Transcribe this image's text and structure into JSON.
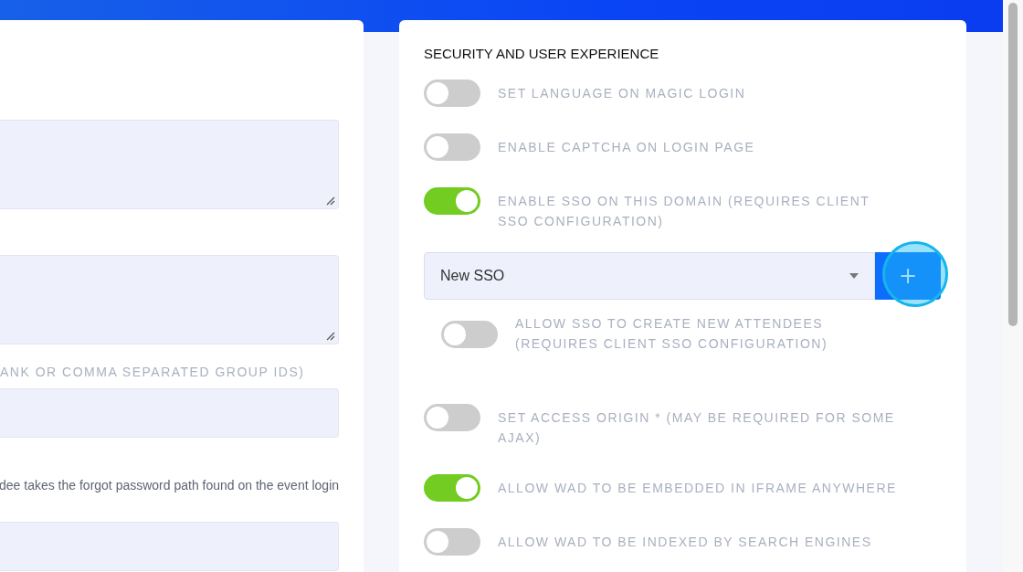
{
  "left_panel": {
    "fields": [
      {
        "kind": "textarea"
      },
      {
        "kind": "textarea"
      },
      {
        "kind": "input",
        "label": "ANK OR COMMA SEPARATED GROUP IDS)"
      },
      {
        "kind": "input",
        "description": "dee takes the forgot password path found on the event login"
      }
    ]
  },
  "security": {
    "title": "SECURITY AND USER EXPERIENCE",
    "items": [
      {
        "kind": "toggle",
        "label": "SET LANGUAGE ON MAGIC LOGIN",
        "on": false
      },
      {
        "kind": "toggle",
        "label": "ENABLE CAPTCHA ON LOGIN PAGE",
        "on": false
      },
      {
        "kind": "toggle",
        "label": "ENABLE SSO ON THIS DOMAIN (REQUIRES CLIENT SSO CONFIGURATION)",
        "on": true
      },
      {
        "kind": "select",
        "value": "New SSO",
        "button": "+"
      },
      {
        "kind": "subtoggle",
        "label": "ALLOW SSO TO CREATE NEW ATTENDEES (REQUIRES CLIENT SSO CONFIGURATION)",
        "on": false
      },
      {
        "kind": "toggle",
        "label": "SET ACCESS ORIGIN * (MAY BE REQUIRED FOR SOME AJAX)",
        "on": false
      },
      {
        "kind": "toggle",
        "label": "ALLOW WAD TO BE EMBEDDED IN IFRAME ANYWHERE",
        "on": true
      },
      {
        "kind": "toggle",
        "label": "ALLOW WAD TO BE INDEXED BY SEARCH ENGINES",
        "on": false
      }
    ]
  }
}
